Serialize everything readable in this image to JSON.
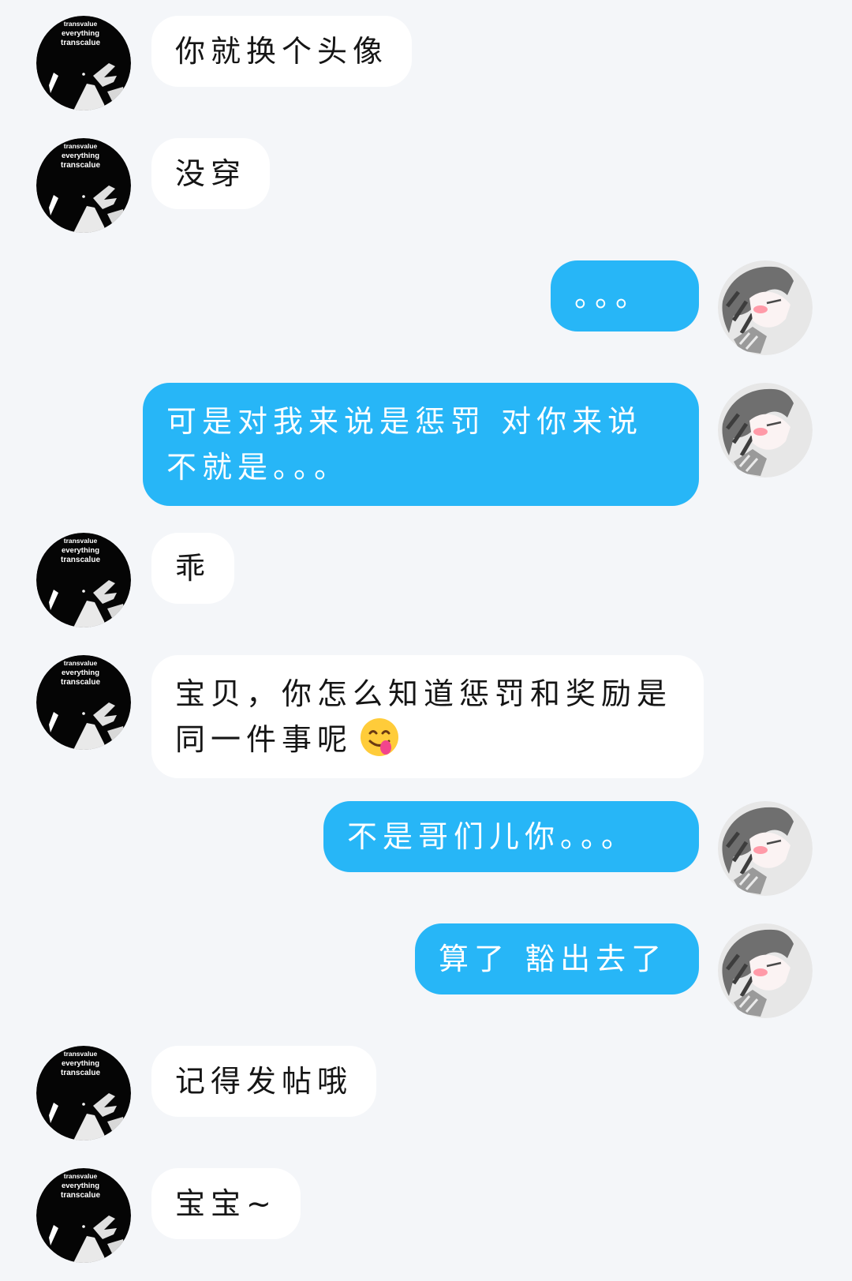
{
  "messages": [
    {
      "side": "in",
      "text": "你就换个头像"
    },
    {
      "side": "in",
      "text": "没穿"
    },
    {
      "side": "out",
      "text": "。。。"
    },
    {
      "side": "out",
      "text": "可是对我来说是惩罚 对你来说不就是。。。"
    },
    {
      "side": "in",
      "text": "乖"
    },
    {
      "side": "in",
      "text": "宝贝，你怎么知道惩罚和奖励是同一件事呢",
      "emoji": "yummy-face-emoji"
    },
    {
      "side": "out",
      "text": "不是哥们儿你。。。"
    },
    {
      "side": "out",
      "text": "算了 豁出去了"
    },
    {
      "side": "in",
      "text": "记得发帖哦"
    },
    {
      "side": "in",
      "text": "宝宝~"
    }
  ],
  "contact_avatar": {
    "text_lines": [
      "transvalue",
      "everything",
      "transcalue"
    ],
    "icon": "dark-illustration-avatar"
  },
  "self_avatar": {
    "icon": "anime-character-avatar"
  },
  "colors": {
    "background": "#f4f6f9",
    "incoming_bubble": "#ffffff",
    "outgoing_bubble": "#27b6f7",
    "outgoing_text": "#ffffff"
  }
}
